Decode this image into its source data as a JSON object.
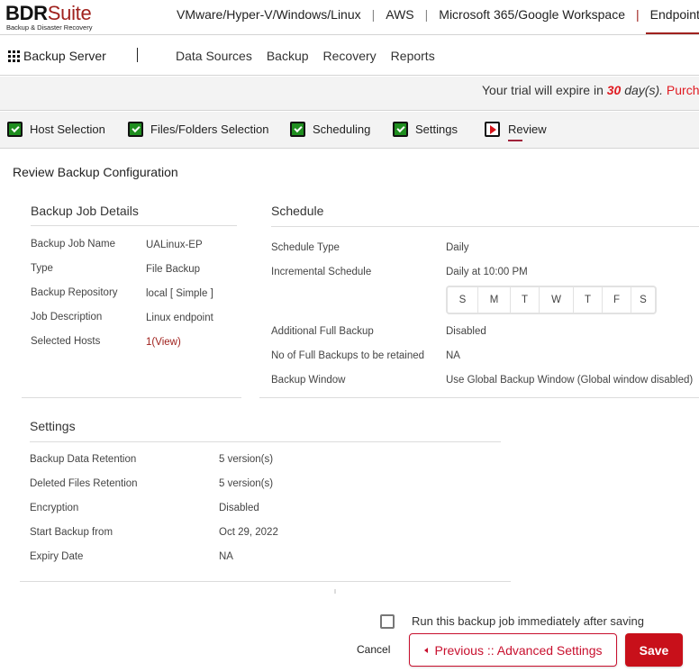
{
  "brand": {
    "name_bold": "BDR",
    "name_light": "Suite",
    "tagline": "Backup & Disaster Recovery",
    "accent_color": "#a0221e"
  },
  "product_nav": {
    "items": [
      {
        "label": "VMware/Hyper-V/Windows/Linux",
        "active": false
      },
      {
        "label": "AWS",
        "active": false
      },
      {
        "label": "Microsoft 365/Google Workspace",
        "active": false
      },
      {
        "label": "Endpoint",
        "active": true
      }
    ],
    "separator": "|"
  },
  "menubar": {
    "app_switcher": "Backup Server",
    "items": [
      "Data Sources",
      "Backup",
      "Recovery",
      "Reports"
    ]
  },
  "trial": {
    "prefix": "Your trial will expire in",
    "days": "30",
    "unit": "day(s).",
    "purchase": "Purcha"
  },
  "wizard": {
    "steps": [
      {
        "label": "Host Selection",
        "status": "complete"
      },
      {
        "label": "Files/Folders Selection",
        "status": "complete"
      },
      {
        "label": "Scheduling",
        "status": "complete"
      },
      {
        "label": "Settings",
        "status": "complete"
      },
      {
        "label": "Review",
        "status": "current"
      }
    ]
  },
  "page": {
    "title": "Review Backup Configuration"
  },
  "job_details": {
    "title": "Backup Job Details",
    "rows": [
      {
        "label": "Backup Job Name",
        "value": "UALinux-EP"
      },
      {
        "label": "Type",
        "value": "File Backup"
      },
      {
        "label": "Backup Repository",
        "value": "local [ Simple ]"
      },
      {
        "label": "Job Description",
        "value": "Linux endpoint"
      },
      {
        "label": "Selected Hosts",
        "value": "1",
        "link": "(View)"
      }
    ]
  },
  "schedule": {
    "title": "Schedule",
    "rows": [
      {
        "label": "Schedule Type",
        "value": "Daily"
      },
      {
        "label": "Incremental Schedule",
        "value": "Daily at 10:00 PM"
      },
      {
        "label": "Additional Full Backup",
        "value": "Disabled"
      },
      {
        "label": "No of Full Backups to be retained",
        "value": "NA"
      },
      {
        "label": "Backup Window",
        "value": "Use Global Backup Window  (Global window disabled)"
      }
    ],
    "days": [
      "S",
      "M",
      "T",
      "W",
      "T",
      "F",
      "S"
    ]
  },
  "settings": {
    "title": "Settings",
    "rows": [
      {
        "label": "Backup Data Retention",
        "value": "5 version(s)"
      },
      {
        "label": "Deleted Files Retention",
        "value": "5 version(s)"
      },
      {
        "label": "Encryption",
        "value": "Disabled"
      },
      {
        "label": "Start Backup from",
        "value": "Oct 29, 2022"
      },
      {
        "label": "Expiry Date",
        "value": "NA"
      }
    ]
  },
  "footer": {
    "run_now_label": "Run this backup job immediately after saving",
    "run_now_checked": false,
    "cancel_label": "Cancel",
    "previous_label": "Previous :: Advanced Settings",
    "save_label": "Save"
  }
}
